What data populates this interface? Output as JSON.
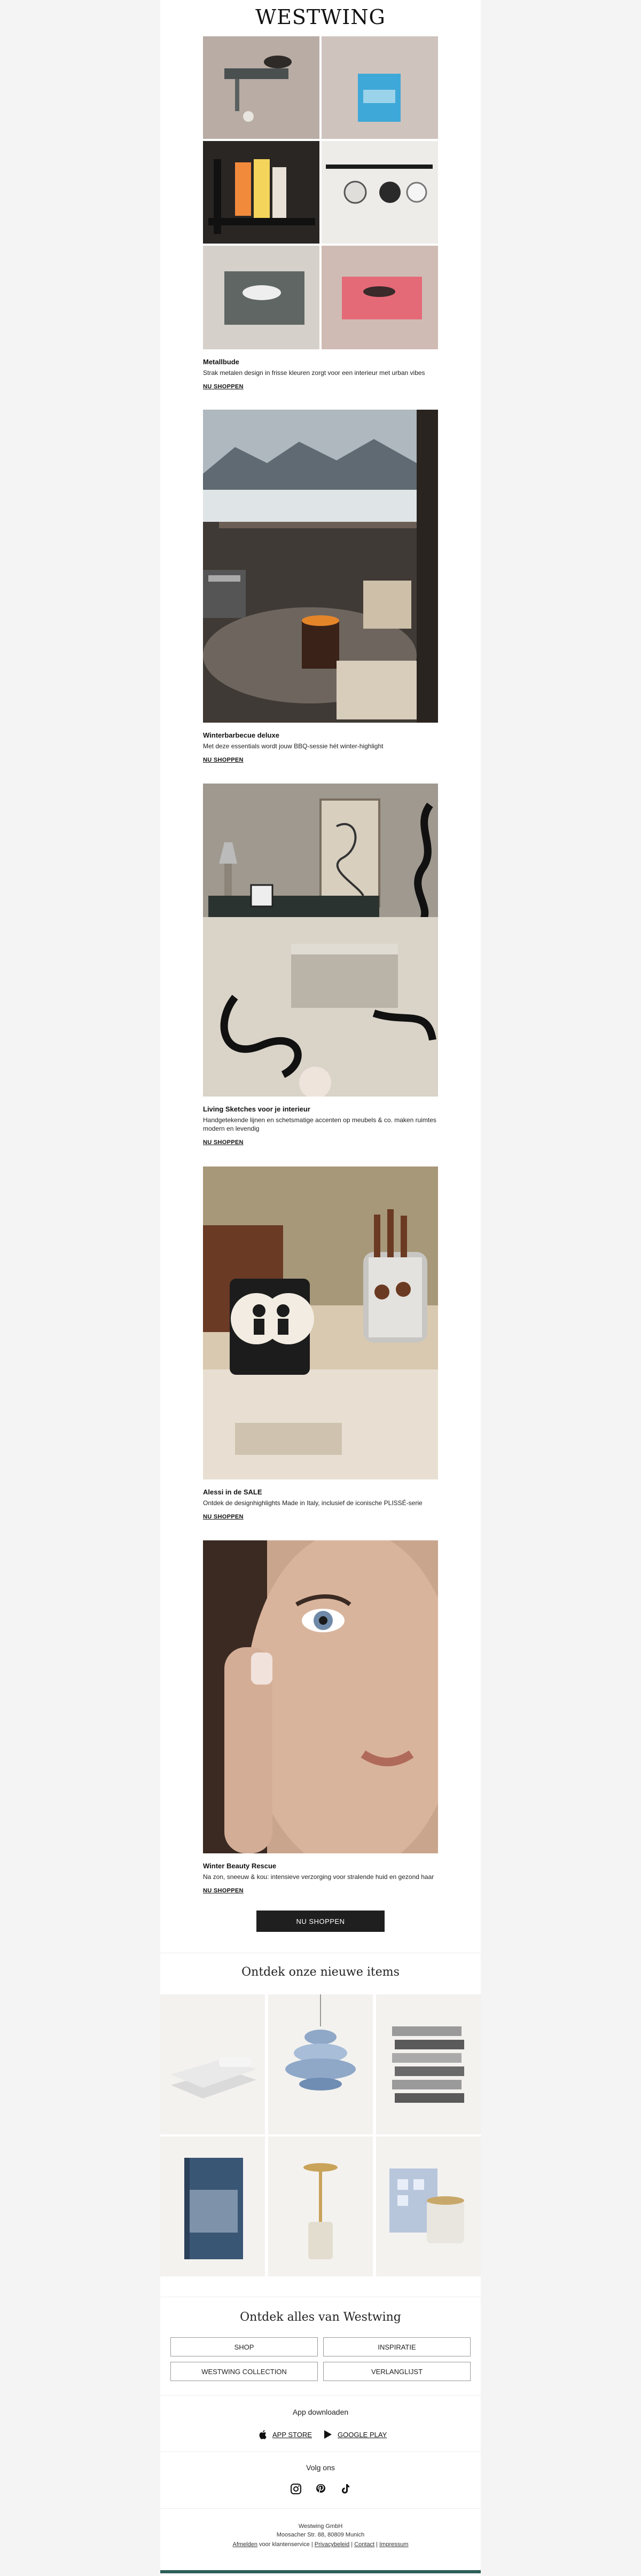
{
  "brand": {
    "logo": "WESTWING"
  },
  "features": [
    {
      "title": "Metallbude",
      "desc": "Strak metalen design in frisse kleuren zorgt voor een interieur met urban vibes",
      "cta": "NU SHOPPEN"
    },
    {
      "title": "Winterbarbecue deluxe",
      "desc": "Met deze essentials wordt jouw BBQ-sessie hét winter-highlight",
      "cta": "NU SHOPPEN"
    },
    {
      "title": "Living Sketches voor je interieur",
      "desc": "Handgetekende lijnen en schetsmatige accenten op meubels & co. maken ruimtes modern en levendig",
      "cta": "NU SHOPPEN"
    },
    {
      "title": "Alessi in de SALE",
      "desc": "Ontdek de designhighlights Made in Italy, inclusief de iconische PLISSÉ-serie",
      "cta": "NU SHOPPEN"
    },
    {
      "title": "Winter Beauty Rescue",
      "desc": "Na zon, sneeuw & kou: intensieve verzorging voor stralende huid en gezond haar",
      "cta": "NU SHOPPEN"
    }
  ],
  "main_cta": "NU SHOPPEN",
  "new_items": {
    "title": "Ontdek onze nieuwe items"
  },
  "all": {
    "title": "Ontdek alles van Westwing",
    "buttons": [
      "SHOP",
      "INSPIRATIE",
      "WESTWING COLLECTION",
      "VERLANGLIJST"
    ]
  },
  "app": {
    "title": "App downloaden",
    "app_store": "APP STORE",
    "google_play": "GOOGLE PLAY"
  },
  "follow": {
    "title": "Volg ons",
    "icons": [
      "instagram-icon",
      "pinterest-icon",
      "tiktok-icon"
    ]
  },
  "footer": {
    "company": "Westwing GmbH",
    "address": "Moosacher Str. 88, 80809 Munich",
    "links": [
      "Afmelden",
      "voor klantenservice",
      "Privacybeleid",
      "Contact",
      "Impressum"
    ]
  }
}
